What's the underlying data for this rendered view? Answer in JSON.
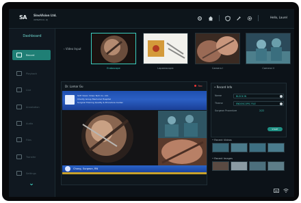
{
  "header": {
    "logo_mark": "SA",
    "company_name": "SinoVision Ltd.",
    "company_sub": "WENZHOU, ZJ",
    "user_greeting": "Hello, Laurel"
  },
  "sidebar": {
    "title": "Dashboard",
    "items": [
      {
        "label": "Record",
        "active": true
      },
      {
        "label": "Playback",
        "active": false
      },
      {
        "label": "Live",
        "active": false
      },
      {
        "label": "Annotation",
        "active": false
      },
      {
        "label": "Audio",
        "active": false
      },
      {
        "label": "Files",
        "active": false
      },
      {
        "label": "Transfer",
        "active": false
      },
      {
        "label": "Settings",
        "active": false
      }
    ]
  },
  "video_input": {
    "label": "‹ Video Input",
    "sources": [
      {
        "label": "Endoscope",
        "selected": true
      },
      {
        "label": "Laparoscopic",
        "selected": false
      },
      {
        "label": "Camera I",
        "selected": false
      },
      {
        "label": "Camera II",
        "selected": false
      }
    ]
  },
  "main": {
    "doctor": "Dr. Lamar Gu",
    "record_state": "Rec",
    "banner_lines": [
      "SCH Vision Video Tech Co. Ltd.",
      "Charity Group Memorial Hospital",
      "Surgical Training Quality & Procedure Center"
    ],
    "caption": "Chang, Surgeon, RN"
  },
  "record_info": {
    "title": "• Record Info",
    "rows": [
      {
        "label": "Name",
        "value": "BLOCK IN"
      },
      {
        "label": "Theme",
        "value": "ENDOSCOPIC FILE"
      },
      {
        "label": "Surgeon Procedure",
        "value": "2/22"
      }
    ],
    "button": "START"
  },
  "previews": {
    "videos_title": "• Recent Videos",
    "images_title": "• Recent Images"
  }
}
